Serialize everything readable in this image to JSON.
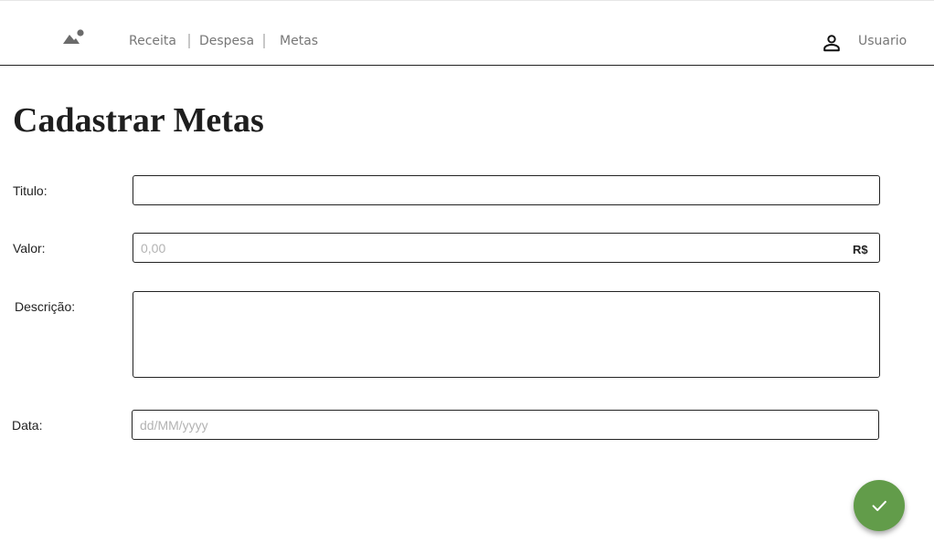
{
  "nav": {
    "links": [
      "Receita",
      "Despesa",
      "Metas"
    ],
    "user_label": "Usuario",
    "logo_icon": "landscape-icon",
    "user_icon": "person-icon"
  },
  "page": {
    "title": "Cadastrar Metas"
  },
  "form": {
    "titulo": {
      "label": "Titulo:",
      "value": "",
      "placeholder": ""
    },
    "valor": {
      "label": "Valor:",
      "value": "",
      "placeholder": "0,00",
      "currency": "R$"
    },
    "descricao": {
      "label": "Descrição:",
      "value": "",
      "placeholder": ""
    },
    "data": {
      "label": "Data:",
      "value": "",
      "placeholder": "dd/MM/yyyy"
    }
  },
  "submit": {
    "icon": "check-icon",
    "color": "#629c4a"
  }
}
